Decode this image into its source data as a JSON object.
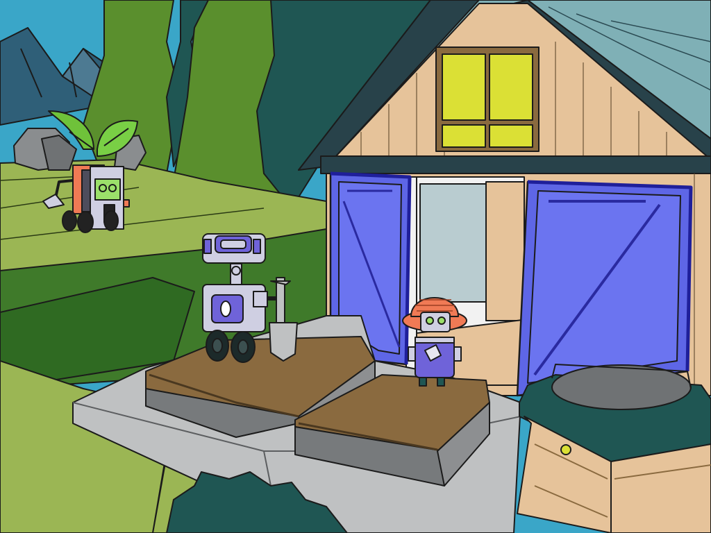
{
  "scene": {
    "palette": {
      "sky": "#3aa6c8",
      "mountain": "#2f5f78",
      "tree_light": "#5a8f2d",
      "tree_dark": "#1f5653",
      "grass": "#9bb654",
      "grass_dark": "#3f7a2a",
      "stone_path": "#bfc1c2",
      "soil": "#8a6a3f",
      "shed_wall": "#e6c39a",
      "shed_trim": "#28424a",
      "roof": "#7fb0b6",
      "door_blue": "#5e66e6",
      "window_yellow": "#dbe035",
      "robot_body": "#cfcfe2",
      "robot_accent": "#6f63d9",
      "robot_eyes": "#9be06a",
      "hat_orange": "#f07a55"
    },
    "objects": [
      "mountains",
      "forest-trees",
      "garden-shed",
      "shed-window",
      "shed-door-left",
      "shed-door-right",
      "stone-patio",
      "garden-bed-left",
      "garden-bed-right",
      "planter-box",
      "bush",
      "rover-robot",
      "shovel-robot",
      "hat-robot"
    ]
  }
}
